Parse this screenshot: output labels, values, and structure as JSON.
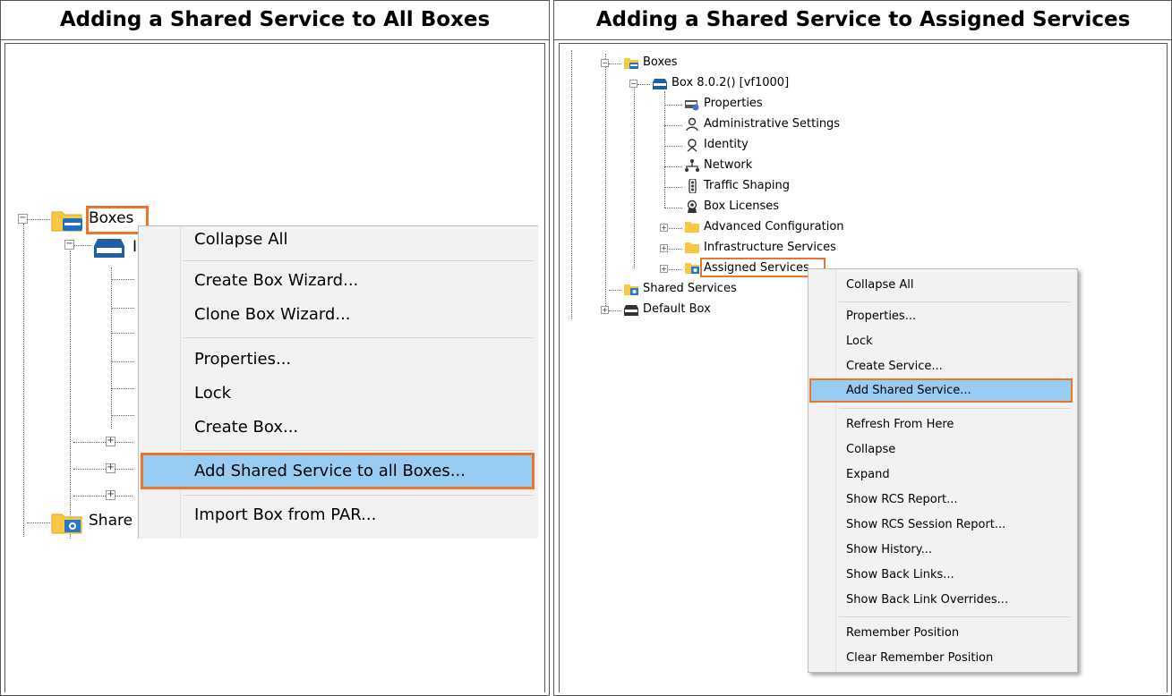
{
  "headers": {
    "left": "Adding a Shared Service to All Boxes",
    "right": "Adding a Shared Service to Assigned Services"
  },
  "left_panel": {
    "tree": {
      "boxes_label": "Boxes",
      "box_partial": "I",
      "shared_partial": "Share"
    },
    "context_menu": {
      "items": [
        {
          "label": "Collapse All"
        },
        {
          "label": "Create Box Wizard..."
        },
        {
          "label": "Clone Box Wizard..."
        },
        {
          "label": "Properties..."
        },
        {
          "label": "Lock"
        },
        {
          "label": "Create Box..."
        },
        {
          "label": "Add Shared Service to all Boxes...",
          "highlighted": true
        },
        {
          "label": "Import Box from PAR..."
        }
      ]
    }
  },
  "right_panel": {
    "tree": {
      "boxes": "Boxes",
      "box": "Box 8.0.2() [vf1000]",
      "children": [
        {
          "label": "Properties",
          "icon": "properties-icon"
        },
        {
          "label": "Administrative Settings",
          "icon": "admin-person-icon"
        },
        {
          "label": "Identity",
          "icon": "identity-badge-icon"
        },
        {
          "label": "Network",
          "icon": "network-icon"
        },
        {
          "label": "Traffic Shaping",
          "icon": "traffic-light-icon"
        },
        {
          "label": "Box Licenses",
          "icon": "license-seal-icon"
        },
        {
          "label": "Advanced Configuration",
          "icon": "folder-icon"
        },
        {
          "label": "Infrastructure Services",
          "icon": "folder-icon"
        },
        {
          "label": "Assigned Services",
          "icon": "service-folder-icon"
        }
      ],
      "shared_services": "Shared Services",
      "default_box": "Default Box"
    },
    "context_menu": {
      "items": [
        {
          "label": "Collapse All"
        },
        {
          "label": "Properties..."
        },
        {
          "label": "Lock"
        },
        {
          "label": "Create Service..."
        },
        {
          "label": "Add Shared Service...",
          "highlighted": true
        },
        {
          "label": "Refresh From Here"
        },
        {
          "label": "Collapse"
        },
        {
          "label": "Expand"
        },
        {
          "label": "Show RCS Report..."
        },
        {
          "label": "Show RCS Session Report..."
        },
        {
          "label": "Show History..."
        },
        {
          "label": "Show Back Links..."
        },
        {
          "label": "Show Back Link Overrides..."
        },
        {
          "label": "Remember Position"
        },
        {
          "label": "Clear Remember Position"
        }
      ]
    }
  },
  "colors": {
    "highlight_border": "#e8772a",
    "menu_selection": "#99ccf3",
    "folder_yellow": "#f8c845",
    "box_blue": "#1f6fbf"
  }
}
